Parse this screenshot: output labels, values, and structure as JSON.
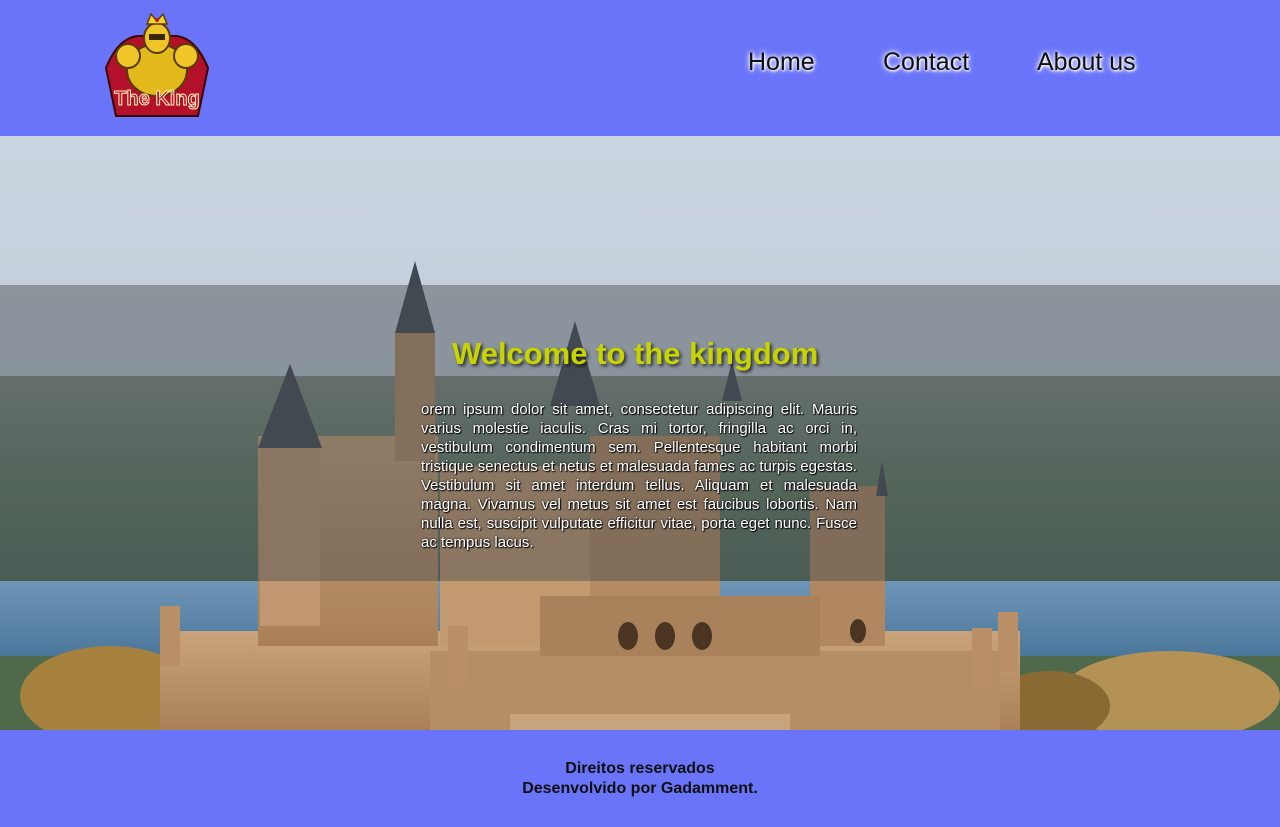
{
  "header": {
    "logo_text": "The King",
    "nav": [
      {
        "label": "Home"
      },
      {
        "label": "Contact"
      },
      {
        "label": "About us"
      }
    ]
  },
  "hero": {
    "title": "Welcome to the kingdom",
    "text": "orem ipsum dolor sit amet, consectetur adipiscing elit. Mauris varius molestie iaculis. Cras mi tortor, fringilla ac orci in, vestibulum condimentum sem. Pellentesque habitant morbi tristique senectus et netus et malesuada fames ac turpis egestas. Vestibulum sit amet interdum tellus. Aliquam et malesuada magna. Vivamus vel metus sit amet est faucibus lobortis. Nam nulla est, suscipit vulputate efficitur vitae, porta eget nunc. Fusce ac tempus lacus."
  },
  "footer": {
    "line1": "Direitos reservados",
    "line2": "Desenvolvido por Gadamment."
  },
  "colors": {
    "bar": "#6a74f8",
    "title": "#c8d400"
  }
}
